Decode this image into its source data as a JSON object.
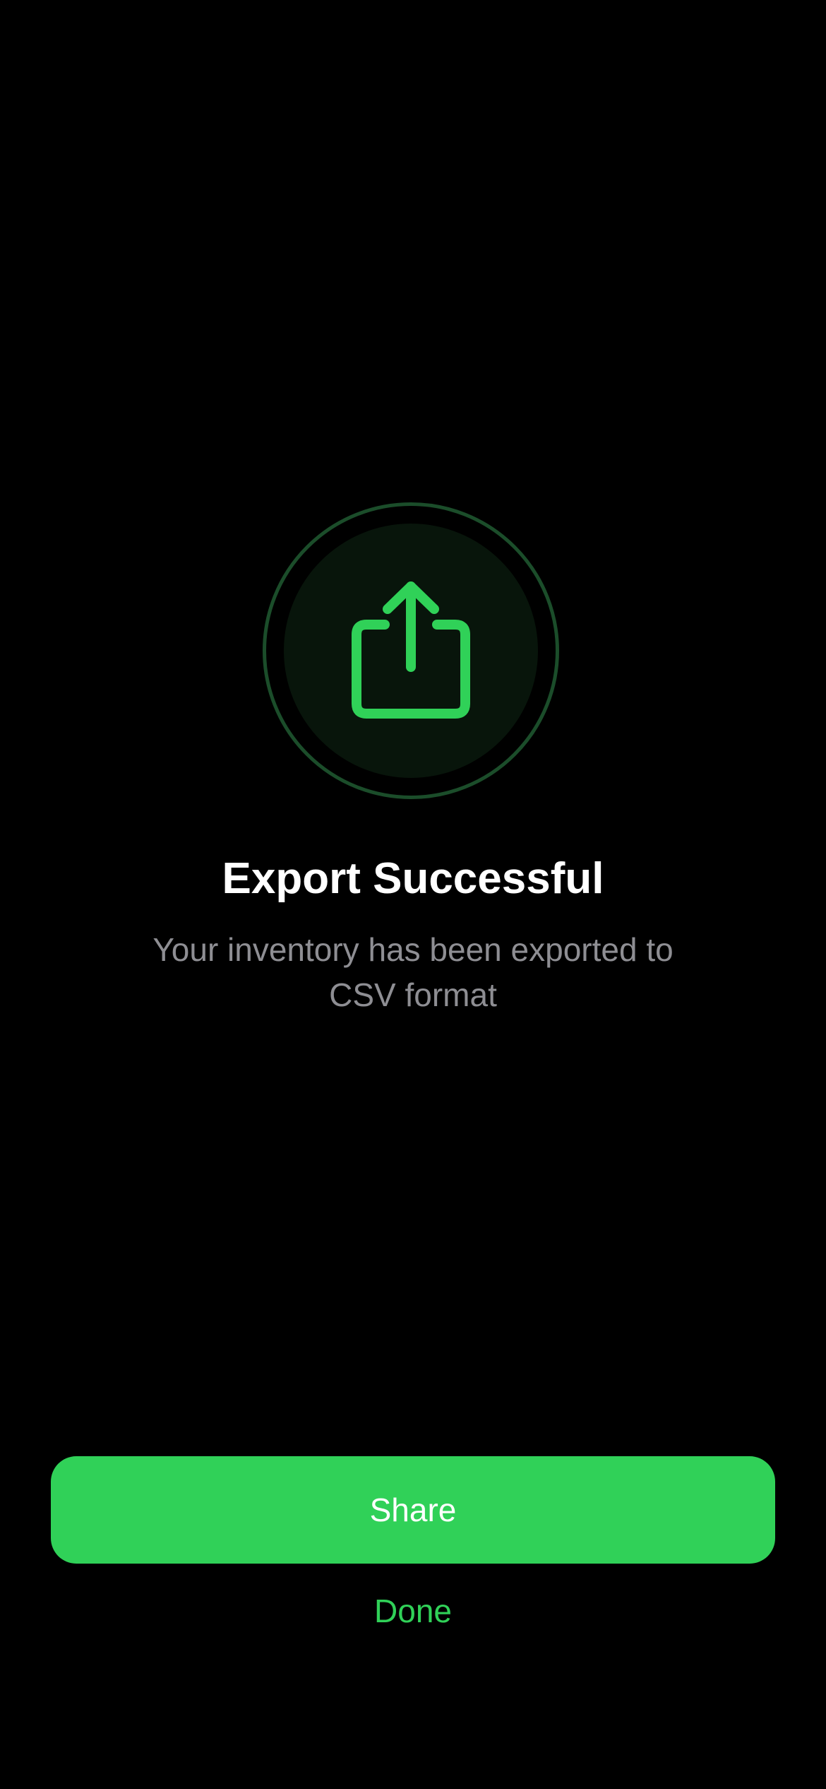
{
  "colors": {
    "background": "#000000",
    "accent": "#30d158",
    "icon_disc": "#08150b",
    "icon_ring": "#1b4d2a",
    "title": "#ffffff",
    "subtitle": "#8e8e93"
  },
  "icon": {
    "name": "share-upload-icon"
  },
  "content": {
    "title": "Export Successful",
    "message": "Your inventory has been exported to CSV format"
  },
  "actions": {
    "share_label": "Share",
    "done_label": "Done"
  }
}
